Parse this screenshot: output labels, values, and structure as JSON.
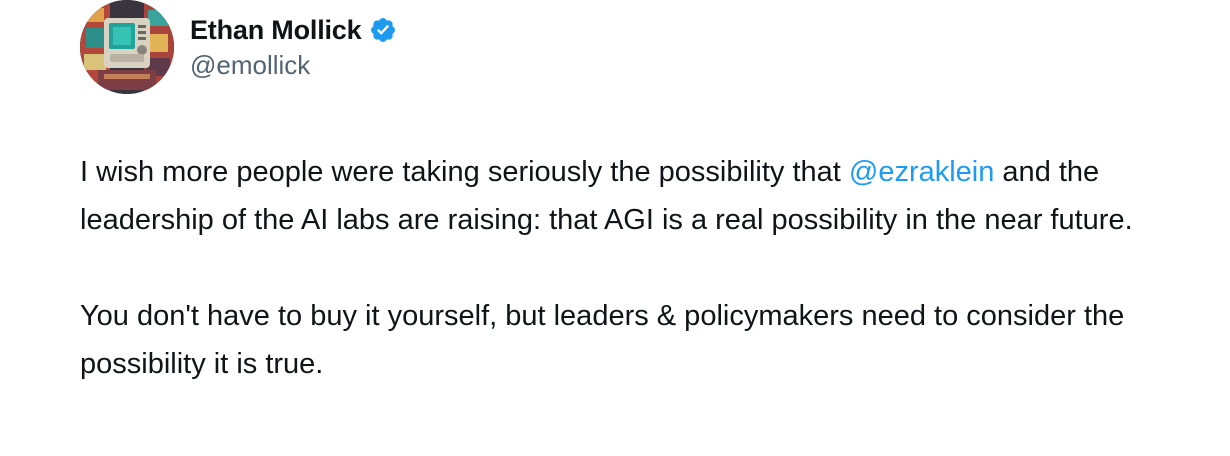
{
  "author": {
    "display_name": "Ethan Mollick",
    "handle": "@emollick",
    "verified": true,
    "verified_icon": "verified-badge-icon",
    "avatar_icon": "retro-computer-avatar"
  },
  "tweet": {
    "paragraph1": {
      "before": "I wish more people were taking seriously the possibility that ",
      "mention": "@ezraklein",
      "after": " and the leadership of the AI labs are raising: that AGI is a real possibility in the near future."
    },
    "paragraph2": "You don't have to buy it yourself, but leaders & policymakers need to consider the possibility it is true."
  },
  "colors": {
    "text": "#0f1419",
    "secondary": "#536471",
    "link": "#1d9bf0",
    "verified": "#1d9bf0"
  }
}
